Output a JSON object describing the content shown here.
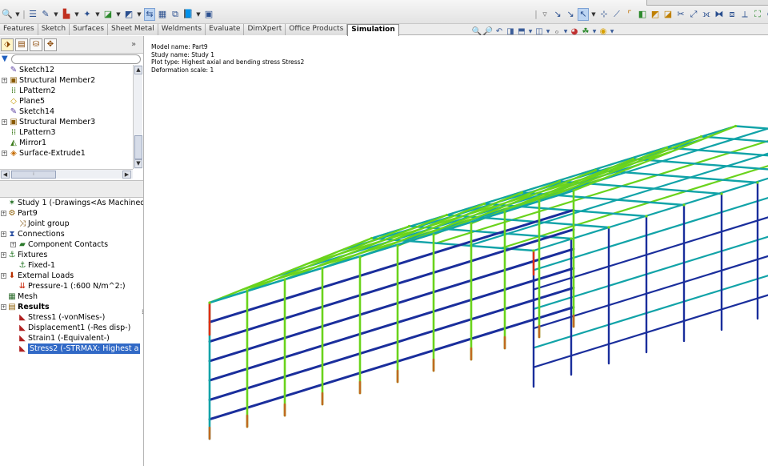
{
  "toolbar": {
    "command_icons": [
      "zoom-icon",
      "dropdown",
      "list-icon",
      "edit-sketch-icon",
      "dropdown",
      "sketch-icon",
      "dropdown",
      "part-icon",
      "dropdown",
      "smart-icon",
      "dropdown",
      "display-icon",
      "dropdown",
      "view-icon",
      "grid-icon",
      "copy-icon",
      "book-icon",
      "save-icon"
    ]
  },
  "command_tabs": [
    {
      "label": "Features"
    },
    {
      "label": "Sketch"
    },
    {
      "label": "Surfaces"
    },
    {
      "label": "Sheet Metal"
    },
    {
      "label": "Weldments"
    },
    {
      "label": "Evaluate"
    },
    {
      "label": "DimXpert"
    },
    {
      "label": "Office Products"
    },
    {
      "label": "Simulation",
      "active": true
    }
  ],
  "panel_tabs": [
    "featuremanager-icon",
    "propertymanager-icon",
    "configuration-icon",
    "dimxpert-icon"
  ],
  "filter": {
    "placeholder": "",
    "value": ""
  },
  "feature_tree": [
    {
      "label": "Sketch12",
      "icon": "sketch-icon",
      "expandable": false
    },
    {
      "label": "Structural Member2",
      "icon": "structural-member-icon",
      "expandable": true
    },
    {
      "label": "LPattern2",
      "icon": "linear-pattern-icon",
      "expandable": false
    },
    {
      "label": "Plane5",
      "icon": "plane-icon",
      "expandable": false
    },
    {
      "label": "Sketch14",
      "icon": "sketch-icon",
      "expandable": false
    },
    {
      "label": "Structural Member3",
      "icon": "structural-member-icon",
      "expandable": true
    },
    {
      "label": "LPattern3",
      "icon": "linear-pattern-icon",
      "expandable": false
    },
    {
      "label": "Mirror1",
      "icon": "mirror-icon",
      "expandable": false
    },
    {
      "label": "Surface-Extrude1",
      "icon": "surface-extrude-icon",
      "expandable": true
    }
  ],
  "study_tree": [
    {
      "label": "Study 1 (-Drawings<As Machined>-)",
      "icon": "study-icon",
      "level": 0
    },
    {
      "label": "Part9",
      "icon": "part-icon",
      "level": 0,
      "expandable": true
    },
    {
      "label": "Joint group",
      "icon": "joint-group-icon",
      "level": 1
    },
    {
      "label": "Connections",
      "icon": "connections-icon",
      "level": 0,
      "expandable": true
    },
    {
      "label": "Component Contacts",
      "icon": "component-contacts-icon",
      "level": 1,
      "expandable": true
    },
    {
      "label": "Fixtures",
      "icon": "fixtures-icon",
      "level": 0,
      "expandable": true
    },
    {
      "label": "Fixed-1",
      "icon": "fixed-icon",
      "level": 1
    },
    {
      "label": "External Loads",
      "icon": "external-loads-icon",
      "level": 0,
      "expandable": true
    },
    {
      "label": "Pressure-1 (:600 N/m^2:)",
      "icon": "pressure-icon",
      "level": 1
    },
    {
      "label": "Mesh",
      "icon": "mesh-icon",
      "level": 0
    },
    {
      "label": "Results",
      "icon": "results-icon",
      "level": 0,
      "expandable": true,
      "bold": true
    },
    {
      "label": "Stress1 (-vonMises-)",
      "icon": "plot-icon",
      "level": 1
    },
    {
      "label": "Displacement1 (-Res disp-)",
      "icon": "plot-icon",
      "level": 1
    },
    {
      "label": "Strain1 (-Equivalent-)",
      "icon": "plot-icon",
      "level": 1
    },
    {
      "label": "Stress2 (-STRMAX: Highest a",
      "icon": "plot-icon",
      "level": 1,
      "selected": true
    }
  ],
  "model_info": {
    "model_name": "Model name: Part9",
    "study_name": "Study name: Study 1",
    "plot_type": "Plot type: Highest axial and bending stress Stress2",
    "deformation_scale": "Deformation scale: 1"
  },
  "colors": {
    "beam_low": "#1a2e9c",
    "beam_mid": "#11a3a8",
    "beam_mid_high": "#6ad31c",
    "beam_high": "#e03010",
    "selection": "#3169c6",
    "active_tab_bg": "#ffffff"
  }
}
